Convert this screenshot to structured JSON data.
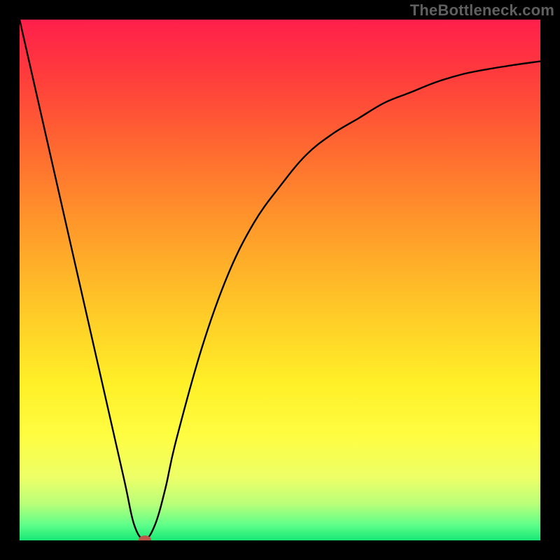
{
  "watermark": "TheBottleneck.com",
  "chart_data": {
    "type": "line",
    "title": "",
    "xlabel": "",
    "ylabel": "",
    "xlim": [
      0,
      100
    ],
    "ylim": [
      0,
      100
    ],
    "grid": false,
    "legend": false,
    "series": [
      {
        "name": "bottleneck-curve",
        "x": [
          0,
          5,
          10,
          15,
          20,
          22,
          24,
          26,
          28,
          30,
          35,
          40,
          45,
          50,
          55,
          60,
          65,
          70,
          75,
          80,
          85,
          90,
          95,
          100
        ],
        "values": [
          100,
          78,
          56,
          34,
          12,
          3,
          0.2,
          3,
          10,
          19,
          37,
          51,
          61,
          68,
          74,
          78,
          81,
          84,
          86,
          88,
          89.5,
          90.5,
          91.3,
          92
        ]
      }
    ],
    "marker": {
      "x": 24,
      "y": 0.2,
      "color": "#bb5a4a"
    },
    "background_gradient": {
      "stops": [
        {
          "pct": 0,
          "color": "#ff1f4b"
        },
        {
          "pct": 10,
          "color": "#ff3a3d"
        },
        {
          "pct": 25,
          "color": "#ff6a30"
        },
        {
          "pct": 40,
          "color": "#ff9a2a"
        },
        {
          "pct": 55,
          "color": "#ffc728"
        },
        {
          "pct": 70,
          "color": "#fff028"
        },
        {
          "pct": 80,
          "color": "#fffd42"
        },
        {
          "pct": 88,
          "color": "#edff68"
        },
        {
          "pct": 93,
          "color": "#b9ff79"
        },
        {
          "pct": 97,
          "color": "#5fff8a"
        },
        {
          "pct": 100,
          "color": "#16e776"
        }
      ]
    },
    "frame_color": "#000000"
  }
}
